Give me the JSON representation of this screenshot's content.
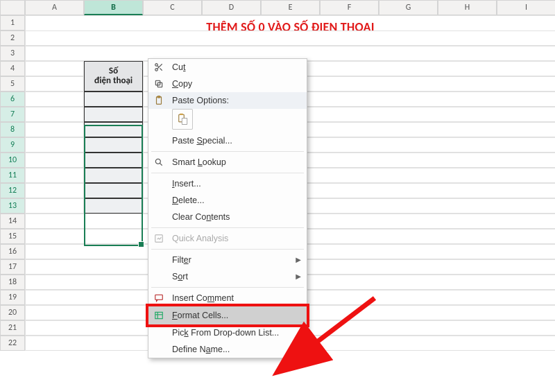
{
  "columns": [
    "A",
    "B",
    "C",
    "D",
    "E",
    "F",
    "G",
    "H",
    "I"
  ],
  "rows": [
    1,
    2,
    3,
    4,
    5,
    6,
    7,
    8,
    9,
    10,
    11,
    12,
    13,
    14,
    15,
    16,
    17,
    18,
    19,
    20,
    21,
    22
  ],
  "active_column": "B",
  "selected_rows": [
    6,
    7,
    8,
    9,
    10,
    11,
    12,
    13
  ],
  "title": "THÊM SỐ 0 VÀO SỐ ĐIỆN THOẠI",
  "table_header": {
    "line1": "Số",
    "line2": "điện thoại"
  },
  "context_menu": {
    "cut": "Cut",
    "copy": "Copy",
    "paste_options": "Paste Options:",
    "paste_special": "Paste Special...",
    "smart_lookup": "Smart Lookup",
    "insert": "Insert...",
    "delete": "Delete...",
    "clear": "Clear Contents",
    "quick_analysis": "Quick Analysis",
    "filter": "Filter",
    "sort": "Sort",
    "insert_comment": "Insert Comment",
    "format_cells": "Format Cells...",
    "pick_list": "Pick From Drop-down List...",
    "define_name": "Define Name..."
  }
}
